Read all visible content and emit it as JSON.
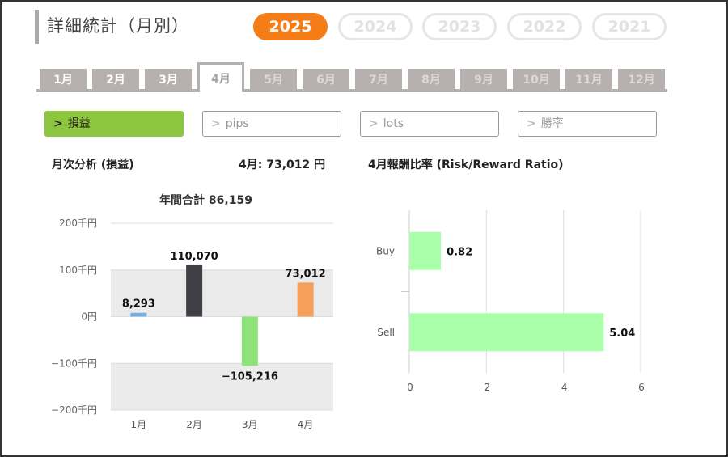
{
  "header": {
    "title": "詳細統計（月別）",
    "years": [
      {
        "label": "2025",
        "active": true
      },
      {
        "label": "2024",
        "active": false
      },
      {
        "label": "2023",
        "active": false
      },
      {
        "label": "2022",
        "active": false
      },
      {
        "label": "2021",
        "active": false
      }
    ]
  },
  "months": [
    {
      "label": "1月",
      "state": "past"
    },
    {
      "label": "2月",
      "state": "past"
    },
    {
      "label": "3月",
      "state": "past"
    },
    {
      "label": "4月",
      "state": "active"
    },
    {
      "label": "5月",
      "state": "future"
    },
    {
      "label": "6月",
      "state": "future"
    },
    {
      "label": "7月",
      "state": "future"
    },
    {
      "label": "8月",
      "state": "future"
    },
    {
      "label": "9月",
      "state": "future"
    },
    {
      "label": "10月",
      "state": "future"
    },
    {
      "label": "11月",
      "state": "future"
    },
    {
      "label": "12月",
      "state": "future"
    }
  ],
  "metrics": [
    {
      "label": "損益",
      "active": true
    },
    {
      "label": "pips",
      "active": false
    },
    {
      "label": "lots",
      "active": false
    },
    {
      "label": "勝率",
      "active": false
    }
  ],
  "chevron": ">",
  "monthly": {
    "heading": "月次分析 (損益)",
    "month_total": "4月:  73,012 円"
  },
  "rr": {
    "heading": "4月報酬比率 (Risk/Reward Ratio)"
  },
  "colors": {
    "accent": "#f47d18",
    "active_metric": "#8cc63f",
    "tab": "#b6b0ae",
    "rr_bar": "#aaffaa"
  },
  "chart_data": [
    {
      "type": "bar",
      "title": "年間合計 86,159",
      "categories": [
        "1月",
        "2月",
        "3月",
        "4月"
      ],
      "values": [
        8293,
        110070,
        -105216,
        73012
      ],
      "value_labels": [
        "8,293",
        "110,070",
        "−105,216",
        "73,012"
      ],
      "bar_colors": [
        "#7ab0e0",
        "#3d3f44",
        "#8ee27a",
        "#f5a05a"
      ],
      "ylim": [
        -200000,
        200000
      ],
      "yticks": [
        200000,
        100000,
        0,
        -100000,
        -200000
      ],
      "ytick_labels": [
        "200千円",
        "100千円",
        "0円",
        "−100千円",
        "−200千円"
      ],
      "shaded_bands": [
        [
          0,
          100000
        ],
        [
          -200000,
          -100000
        ]
      ],
      "grid": true
    },
    {
      "type": "bar",
      "orientation": "horizontal",
      "categories": [
        "Buy",
        "Sell"
      ],
      "values": [
        0.82,
        5.04
      ],
      "value_labels": [
        "0.82",
        "5.04"
      ],
      "xlim": [
        0,
        6
      ],
      "xticks": [
        0,
        2,
        4,
        6
      ],
      "xtick_labels": [
        "0",
        "2",
        "4",
        "6"
      ],
      "grid": true
    }
  ]
}
